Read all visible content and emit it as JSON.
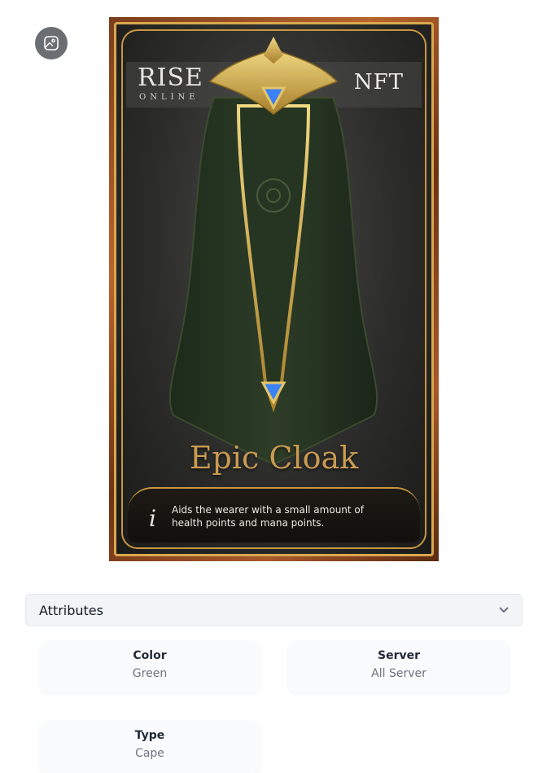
{
  "card": {
    "logo_main": "RISE",
    "logo_sub": "ONLINE",
    "badge": "NFT",
    "item_name": "Epic Cloak",
    "info_glyph": "i",
    "description": "Aids the wearer with a small amount of health points and mana points."
  },
  "image_button": {
    "icon": "image-icon"
  },
  "attributes": {
    "title": "Attributes",
    "toggle_icon": "chevron-down-icon",
    "items": [
      {
        "label": "Color",
        "value": "Green"
      },
      {
        "label": "Server",
        "value": "All Server"
      },
      {
        "label": "Type",
        "value": "Cape"
      }
    ]
  },
  "colors": {
    "gold": "#c99a52",
    "frame": "#b8642e",
    "gem": "#3b82f6",
    "panel": "#f3f4f6"
  }
}
